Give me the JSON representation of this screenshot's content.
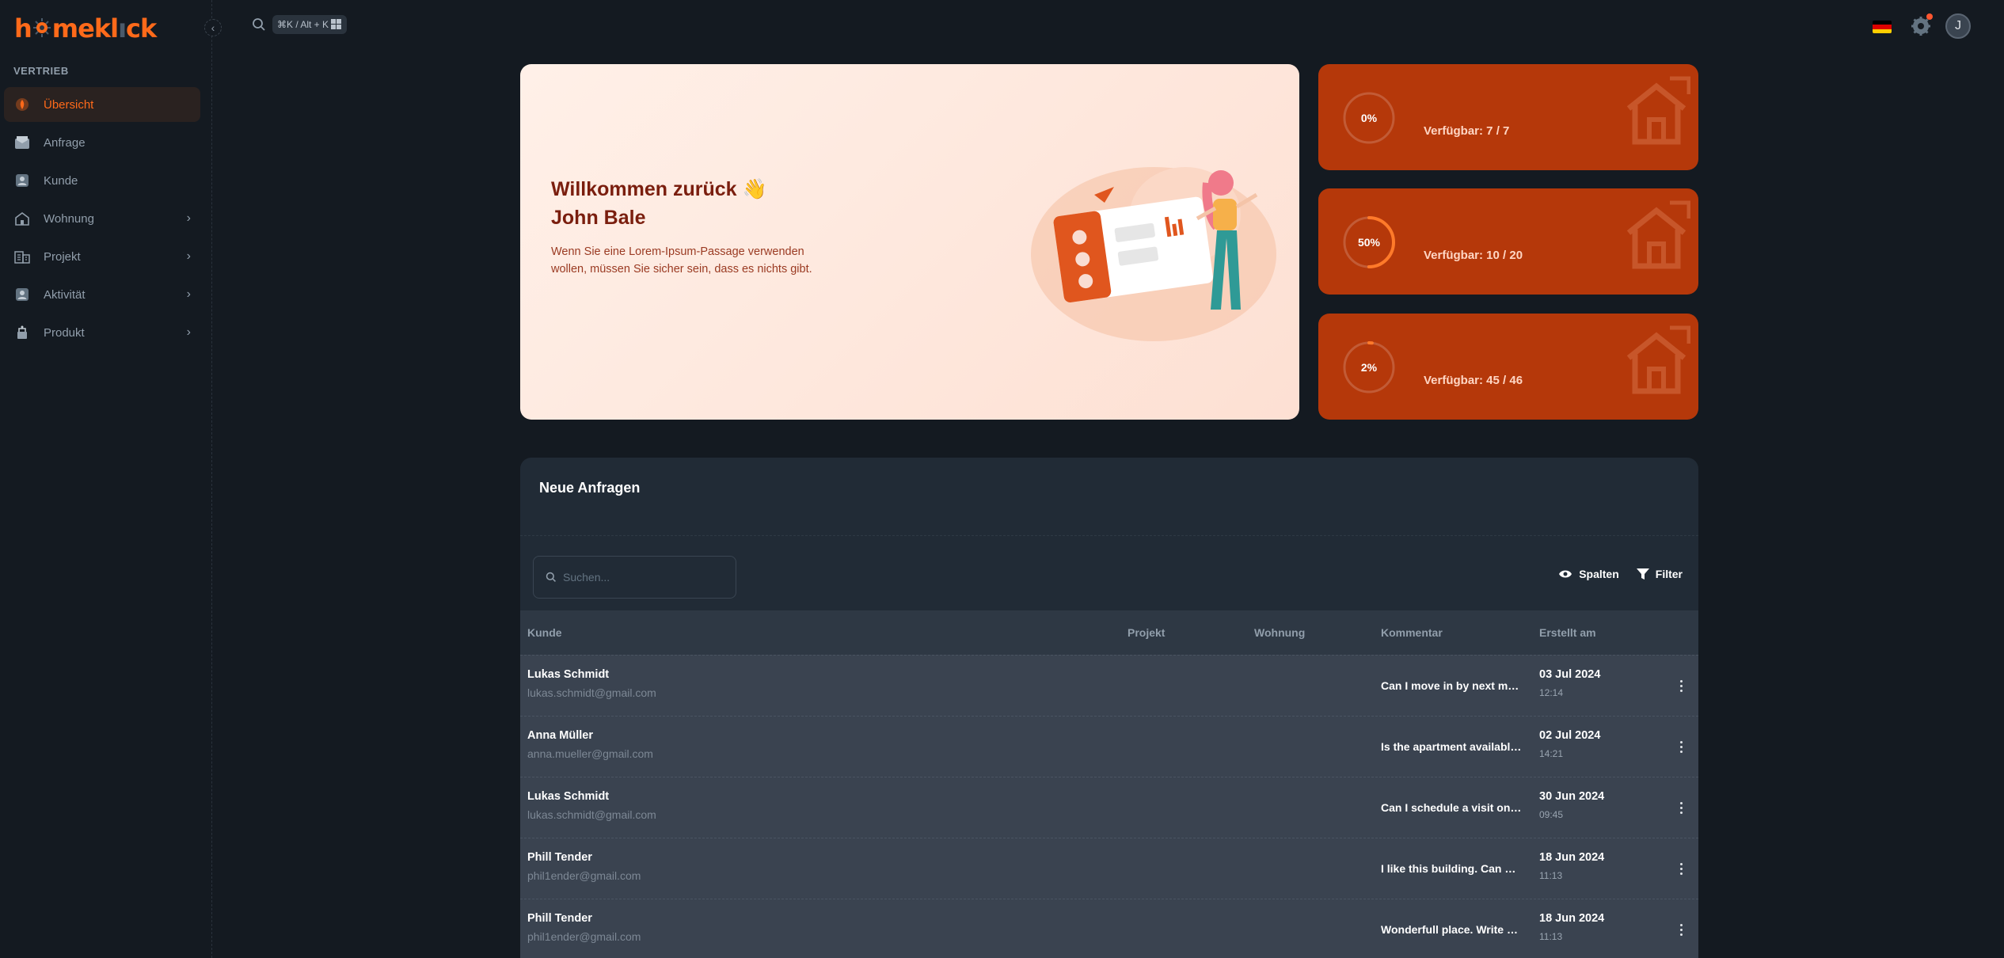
{
  "app": {
    "logo_text_1": "h",
    "logo_text_2": "mekl",
    "logo_text_3": "ck"
  },
  "topbar": {
    "shortcut": "⌘K  / Alt + K"
  },
  "sidebar": {
    "section": "VERTRIEB",
    "items": [
      {
        "label": "Übersicht",
        "icon": "dashboard-icon",
        "active": true
      },
      {
        "label": "Anfrage",
        "icon": "mail-icon"
      },
      {
        "label": "Kunde",
        "icon": "user-icon"
      },
      {
        "label": "Wohnung",
        "icon": "home-icon",
        "chevron": true
      },
      {
        "label": "Projekt",
        "icon": "building-icon",
        "chevron": true
      },
      {
        "label": "Aktivität",
        "icon": "activity-icon",
        "chevron": true
      },
      {
        "label": "Produkt",
        "icon": "product-icon",
        "chevron": true
      }
    ]
  },
  "welcome": {
    "line1": "Willkommen zurück 👋",
    "line2": "John Bale",
    "description": "Wenn Sie eine Lorem-Ipsum-Passage verwenden wollen, müssen Sie sicher sein, dass es nichts gibt."
  },
  "stats": [
    {
      "percent_label": "0%",
      "percent": 0,
      "available": "Verfügbar: 7 / 7"
    },
    {
      "percent_label": "50%",
      "percent": 50,
      "available": "Verfügbar: 10 / 20"
    },
    {
      "percent_label": "2%",
      "percent": 2,
      "available": "Verfügbar: 45 / 46"
    }
  ],
  "requests": {
    "title": "Neue Anfragen",
    "search_placeholder": "Suchen...",
    "columns_label": "Spalten",
    "filter_label": "Filter",
    "headers": [
      "Kunde",
      "Projekt",
      "Wohnung",
      "Kommentar",
      "Erstellt am"
    ],
    "rows": [
      {
        "name": "Lukas Schmidt",
        "email": "lukas.schmidt@gmail.com",
        "comment": "Can I move in by next month?",
        "date": "03 Jul 2024",
        "time": "12:14"
      },
      {
        "name": "Anna Müller",
        "email": "anna.mueller@gmail.com",
        "comment": "Is the apartment available?",
        "date": "02 Jul 2024",
        "time": "14:21"
      },
      {
        "name": "Lukas Schmidt",
        "email": "lukas.schmidt@gmail.com",
        "comment": "Can I schedule a visit on Friday?",
        "date": "30 Jun 2024",
        "time": "09:45"
      },
      {
        "name": "Phill Tender",
        "email": "phil1ender@gmail.com",
        "comment": "I like this building. Can we talk?",
        "date": "18 Jun 2024",
        "time": "11:13"
      },
      {
        "name": "Phill Tender",
        "email": "phil1ender@gmail.com",
        "comment": "Wonderfull place. Write me back.",
        "date": "18 Jun 2024",
        "time": "11:13"
      }
    ]
  },
  "colors": {
    "accent": "#ff6a1a",
    "stat_card": "#b5380a",
    "background": "#141a21"
  }
}
